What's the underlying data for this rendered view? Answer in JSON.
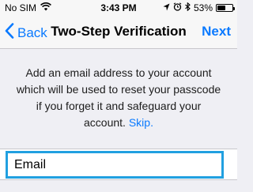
{
  "status_bar": {
    "carrier": "No SIM",
    "time": "3:43 PM",
    "battery_percent_label": "53%",
    "battery_level": 0.53,
    "icons": [
      "wifi-icon",
      "location-arrow-icon",
      "alarm-clock-icon",
      "bluetooth-icon",
      "battery-icon"
    ]
  },
  "nav": {
    "back_label": "Back",
    "title": "Two-Step Verification",
    "next_label": "Next",
    "tint_color": "#0a7aff"
  },
  "description": {
    "text": "Add an email address to your account which will be used to reset your passcode if you forget it and safeguard your account.",
    "skip_label": "Skip."
  },
  "email_field": {
    "placeholder": "Email",
    "value": "",
    "highlight_color": "#21a0e0"
  }
}
